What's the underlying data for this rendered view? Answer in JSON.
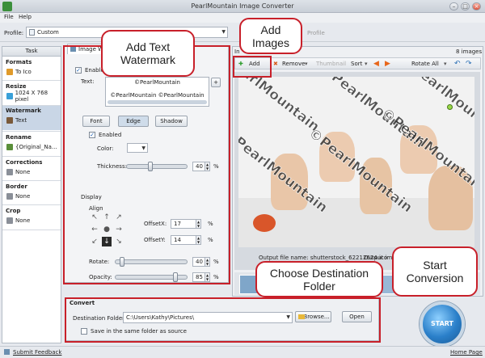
{
  "window": {
    "title": "PearlMountain Image Converter",
    "min": "–",
    "max": "□",
    "close": "×"
  },
  "menu": {
    "file": "File",
    "help": "Help"
  },
  "profile": {
    "label": "Profile:",
    "value": "Custom"
  },
  "tasks": {
    "header": "Task",
    "sections": [
      {
        "title": "Formats",
        "value": "To Ico"
      },
      {
        "title": "Resize",
        "value": "1024 X 768 pixel"
      },
      {
        "title": "Watermark",
        "value": "Text"
      },
      {
        "title": "Rename",
        "value": "{Original_Na..."
      },
      {
        "title": "Corrections",
        "value": "None"
      },
      {
        "title": "Border",
        "value": "None"
      },
      {
        "title": "Crop",
        "value": "None"
      }
    ]
  },
  "watermark": {
    "tab": "Image W",
    "enable_label": "Enable",
    "text_label": "Text:",
    "text_line1": "©PearlMountain",
    "text_line2": "©PearlMountain  ©PearlMountain",
    "plus": "+",
    "font_btn": "Font",
    "edge_btn": "Edge",
    "shadow_btn": "Shadow",
    "enabled_label": "Enabled",
    "color_label": "Color:",
    "thickness_label": "Thickness:",
    "thickness_value": "40",
    "display_label": "Display",
    "align_label": "Align",
    "offsetx_label": "OffsetX:",
    "offsetx_value": "17",
    "offsety_label": "OffsetY:",
    "offsety_value": "14",
    "rotate_label": "Rotate:",
    "rotate_value": "40",
    "opacity_label": "Opacity:",
    "opacity_value": "85",
    "percent": "%",
    "thickness_level": 0.4,
    "rotate_level": 0.1,
    "opacity_level": 0.85
  },
  "images": {
    "title": "In",
    "profile_tab": "Profile",
    "count": "8 images",
    "add": "Add",
    "remove": "Remove",
    "thumbnail": "Thumbnail",
    "sort": "Sort",
    "rotate_all": "Rotate All",
    "watermark_text": "©PearlMountain",
    "output_name": "Output file name: shutterstock_62212624.ico",
    "output_size": "Output image size: 1000 x 667 pixel"
  },
  "convert": {
    "title": "Convert",
    "dest_label": "Destination Folder:",
    "dest_value": "C:\\Users\\Kathy\\Pictures\\",
    "browse": "Browse...",
    "open": "Open",
    "same_folder": "Save in the same folder as source"
  },
  "start": {
    "label": "START"
  },
  "status": {
    "feedback": "Submit Feedback",
    "home": "Home Page"
  },
  "callouts": {
    "watermark": "Add Text Watermark",
    "images": "Add Images",
    "folder": "Choose Destination Folder",
    "start": "Start Conversion"
  },
  "colors": {
    "accent_red": "#c8202a",
    "start_blue": "#2a7fc9",
    "selected": "#c9d6e6"
  }
}
